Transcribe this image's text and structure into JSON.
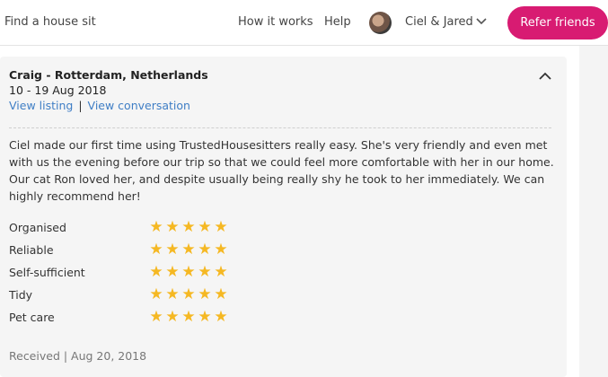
{
  "nav": {
    "find_label": "Find a house sit",
    "how_label": "How it works",
    "help_label": "Help",
    "user_name": "Ciel & Jared",
    "refer_label": "Refer friends"
  },
  "review": {
    "reviewer": "Craig - Rotterdam, Netherlands",
    "dates": "10 - 19 Aug 2018",
    "link_listing": "View listing",
    "link_separator": "|",
    "link_conversation": "View conversation",
    "text": "Ciel made our first time using TrustedHousesitters really easy. She's very friendly and even met with us the evening before our trip so that we could feel more comfortable with her in our home. Our cat Ron loved her, and despite usually being really shy he took to her immediately. We can highly recommend her!",
    "ratings": [
      {
        "label": "Organised",
        "stars": 5
      },
      {
        "label": "Reliable",
        "stars": 5
      },
      {
        "label": "Self-sufficient",
        "stars": 5
      },
      {
        "label": "Tidy",
        "stars": 5
      },
      {
        "label": "Pet care",
        "stars": 5
      }
    ],
    "received": "Received | Aug 20, 2018"
  },
  "colors": {
    "accent": "#d81b72",
    "link": "#3f7ec5",
    "star": "#f5b823",
    "card_bg": "#f5f5f5"
  }
}
